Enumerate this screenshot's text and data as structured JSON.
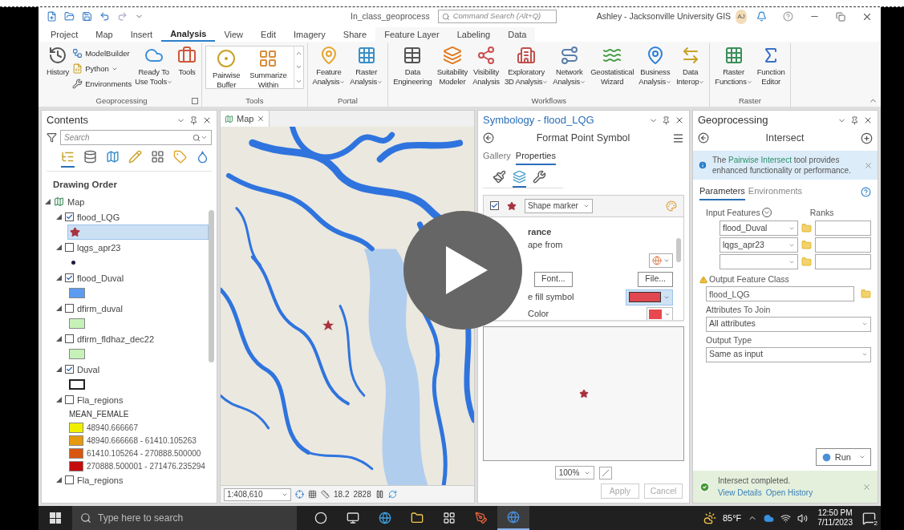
{
  "title_bar": {
    "project": "In_class_geoprocess",
    "search_placeholder": "Command Search (Alt+Q)",
    "user": "Ashley - Jacksonville University GIS",
    "initials": "AJ"
  },
  "ribbon_tabs": [
    {
      "label": "Project",
      "selected": false,
      "kind": "core"
    },
    {
      "label": "Map",
      "selected": false,
      "kind": "core"
    },
    {
      "label": "Insert",
      "selected": false,
      "kind": "core"
    },
    {
      "label": "Analysis",
      "selected": true,
      "kind": "core"
    },
    {
      "label": "View",
      "selected": false,
      "kind": "core"
    },
    {
      "label": "Edit",
      "selected": false,
      "kind": "core"
    },
    {
      "label": "Imagery",
      "selected": false,
      "kind": "core"
    },
    {
      "label": "Share",
      "selected": false,
      "kind": "core"
    },
    {
      "label": "Feature Layer",
      "selected": false,
      "kind": "contextual"
    },
    {
      "label": "Labeling",
      "selected": false,
      "kind": "contextual"
    },
    {
      "label": "Data",
      "selected": false,
      "kind": "contextual"
    }
  ],
  "ribbon_groups": [
    {
      "title": "Geoprocessing",
      "launcher": true,
      "items": [
        {
          "kind": "large",
          "lines": [
            "History"
          ],
          "dropdown": false
        },
        {
          "kind": "small",
          "lines": [
            "ModelBuilder"
          ],
          "dropdown": false
        },
        {
          "kind": "small",
          "lines": [
            "Python"
          ],
          "dropdown": true
        },
        {
          "kind": "small",
          "lines": [
            "Environments"
          ],
          "dropdown": false
        },
        {
          "kind": "large",
          "lines": [
            "Ready To",
            "Use Tools"
          ],
          "dropdown": true
        },
        {
          "kind": "large",
          "lines": [
            "Tools"
          ],
          "dropdown": false
        }
      ]
    },
    {
      "title": "Tools",
      "launcher": false,
      "items": [
        {
          "kind": "gallery",
          "lines": [
            "Pairwise",
            "Buffer"
          ],
          "dropdown": false
        },
        {
          "kind": "gallery",
          "lines": [
            "Summarize",
            "Within"
          ],
          "dropdown": false
        }
      ]
    },
    {
      "title": "Portal",
      "launcher": false,
      "items": [
        {
          "kind": "large",
          "lines": [
            "Feature",
            "Analysis"
          ],
          "dropdown": true
        },
        {
          "kind": "large",
          "lines": [
            "Raster",
            "Analysis"
          ],
          "dropdown": true
        }
      ]
    },
    {
      "title": "Workflows",
      "launcher": false,
      "items": [
        {
          "kind": "large",
          "lines": [
            "Data",
            "Engineering"
          ],
          "dropdown": false
        },
        {
          "kind": "large",
          "lines": [
            "Suitability",
            "Modeler"
          ],
          "dropdown": false
        },
        {
          "kind": "large",
          "lines": [
            "Visibility",
            "Analysis"
          ],
          "dropdown": false
        },
        {
          "kind": "large",
          "lines": [
            "Exploratory",
            "3D Analysis"
          ],
          "dropdown": true
        },
        {
          "kind": "large",
          "lines": [
            "Network",
            "Analysis"
          ],
          "dropdown": true
        },
        {
          "kind": "large",
          "lines": [
            "Geostatistical",
            "Wizard"
          ],
          "dropdown": false
        },
        {
          "kind": "large",
          "lines": [
            "Business",
            "Analysis"
          ],
          "dropdown": true
        },
        {
          "kind": "large",
          "lines": [
            "Data",
            "Interop"
          ],
          "dropdown": true
        }
      ]
    },
    {
      "title": "Raster",
      "launcher": false,
      "items": [
        {
          "kind": "large",
          "lines": [
            "Raster",
            "Functions"
          ],
          "dropdown": true
        },
        {
          "kind": "large",
          "lines": [
            "Function",
            "Editor"
          ],
          "dropdown": false
        }
      ]
    }
  ],
  "contents": {
    "title": "Contents",
    "search_placeholder": "Search",
    "views": [
      {
        "selected": true
      },
      {
        "selected": false
      },
      {
        "selected": false
      },
      {
        "selected": false
      },
      {
        "selected": false
      },
      {
        "selected": false
      },
      {
        "selected": false
      }
    ],
    "heading": "Drawing Order",
    "tree": [
      {
        "kind": "map",
        "name": "Map",
        "expanded": true,
        "children": [
          {
            "kind": "layer",
            "name": "flood_LQG",
            "checked": true,
            "expanded": true,
            "symbols": [
              {
                "kind": "star",
                "color": "#a8323e",
                "selected": true
              }
            ]
          },
          {
            "kind": "layer",
            "name": "lqgs_apr23",
            "checked": false,
            "expanded": true,
            "symbols": [
              {
                "kind": "dot",
                "color": "#1c1c3c",
                "selected": false
              }
            ]
          },
          {
            "kind": "layer",
            "name": "flood_Duval",
            "checked": true,
            "expanded": true,
            "symbols": [
              {
                "kind": "fill",
                "color": "#5b9cf0",
                "selected": false
              }
            ]
          },
          {
            "kind": "layer",
            "name": "dfirm_duval",
            "checked": false,
            "expanded": true,
            "symbols": [
              {
                "kind": "fill",
                "color": "#c6f2b8",
                "selected": false
              }
            ]
          },
          {
            "kind": "layer",
            "name": "dfirm_fldhaz_dec22",
            "checked": false,
            "expanded": true,
            "symbols": [
              {
                "kind": "fill",
                "color": "#c6f2b8",
                "selected": false
              }
            ]
          },
          {
            "kind": "layer",
            "name": "Duval",
            "checked": true,
            "expanded": true,
            "symbols": [
              {
                "kind": "outline",
                "color": "#222222",
                "selected": false
              }
            ]
          },
          {
            "kind": "layer",
            "name": "Fla_regions",
            "checked": false,
            "expanded": true,
            "legend": {
              "field": "MEAN_FEMALE",
              "classes": [
                {
                  "label": "48940.666667",
                  "color": "#f0ef00"
                },
                {
                  "label": "48940.666668 - 61410.105263",
                  "color": "#e59a10"
                },
                {
                  "label": "61410.105264 - 270888.500000",
                  "color": "#d9560f"
                },
                {
                  "label": "270888.500001 - 271476.235294",
                  "color": "#c40c0c"
                }
              ]
            }
          },
          {
            "kind": "layer",
            "name": "Fla_regions",
            "checked": false,
            "expanded": true
          }
        ]
      }
    ]
  },
  "map_view": {
    "tab": "Map",
    "scale": "1:408,610",
    "readouts": [
      "18.2",
      "2828"
    ]
  },
  "symbology": {
    "title": "Symbology - flood_LQG",
    "subtitle": "Format Point Symbol",
    "tabs": [
      {
        "label": "Gallery",
        "selected": false
      },
      {
        "label": "Properties",
        "selected": true
      }
    ],
    "views": [
      {
        "selected": false
      },
      {
        "selected": true
      },
      {
        "selected": false
      }
    ],
    "layer": {
      "checked": true,
      "type": "Shape marker"
    },
    "section_heading": "rance",
    "section_text": "ape from",
    "buttons": [
      "Font...",
      "File..."
    ],
    "fill": {
      "label": "e fill symbol",
      "color": "#e0474f"
    },
    "color_row": {
      "label": "Color",
      "color": "#e8484e"
    },
    "zoom": "100%",
    "actions": [
      {
        "label": "Apply",
        "disabled": true
      },
      {
        "label": "Cancel",
        "disabled": true
      }
    ]
  },
  "geoprocessing": {
    "title": "Geoprocessing",
    "tool": "Intersect",
    "notice": {
      "before": "The ",
      "link": "Pairwise Intersect",
      "after": " tool provides enhanced functionality or performance."
    },
    "tabs": [
      {
        "label": "Parameters",
        "selected": true
      },
      {
        "label": "Environments",
        "selected": false
      }
    ],
    "input_label": "Input Features",
    "ranks_label": "Ranks",
    "inputs": [
      "flood_Duval",
      "lqgs_apr23"
    ],
    "output": {
      "label": "Output Feature Class",
      "value": "flood_LQG",
      "warning": true
    },
    "attributes": {
      "label": "Attributes To Join",
      "value": "All attributes"
    },
    "output_type": {
      "label": "Output Type",
      "value": "Same as input"
    },
    "run": "Run",
    "message": {
      "text": "Intersect completed.",
      "links": [
        "View Details",
        "Open History"
      ]
    }
  },
  "taskbar": {
    "search_placeholder": "Type here to search",
    "apps": [
      {
        "selected": false
      },
      {
        "selected": false
      },
      {
        "selected": false
      },
      {
        "selected": false
      },
      {
        "selected": false
      },
      {
        "selected": false
      },
      {
        "selected": true
      }
    ],
    "weather": "85°F",
    "time": "12:50 PM",
    "date": "7/11/2023",
    "notifications": "2"
  }
}
